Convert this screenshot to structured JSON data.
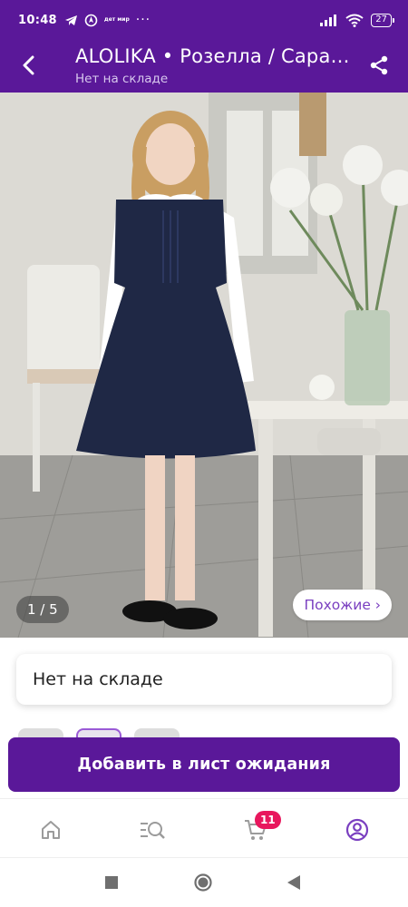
{
  "status_bar": {
    "time": "10:48",
    "app_logo_text": "дет мир",
    "more": "···",
    "battery": "27",
    "icons": [
      "telegram-icon",
      "vpn-icon",
      "app-logo-icon",
      "signal-icon",
      "wifi-icon",
      "battery-icon"
    ]
  },
  "header": {
    "title": "ALOLIKA • Розелла / Сарафан для девочки",
    "subtitle": "Нет на складе",
    "back_icon": "arrow-left-icon",
    "share_icon": "share-icon"
  },
  "gallery": {
    "counter": "1 / 5",
    "current": 1,
    "total": 5,
    "similar_label": "Похожие ›"
  },
  "stock": {
    "label": "Нет на складе"
  },
  "cta": {
    "label": "Добавить в лист ожидания"
  },
  "bottom_nav": {
    "items": [
      {
        "name": "home",
        "icon": "home-icon"
      },
      {
        "name": "catalog-search",
        "icon": "catalog-search-icon"
      },
      {
        "name": "cart",
        "icon": "cart-icon"
      },
      {
        "name": "profile",
        "icon": "profile-icon"
      }
    ],
    "cart_badge": "11",
    "active": "profile"
  },
  "colors": {
    "brand": "#5a1899",
    "accent": "#7a3fc0",
    "badge": "#e8175d"
  }
}
